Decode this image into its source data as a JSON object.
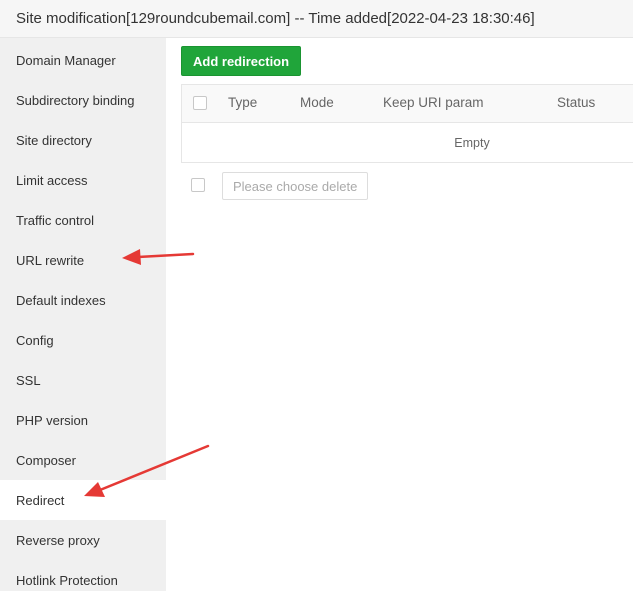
{
  "title": "Site modification[129roundcubemail.com] -- Time added[2022-04-23 18:30:46]",
  "sidebar": {
    "items": [
      {
        "label": "Domain Manager"
      },
      {
        "label": "Subdirectory binding"
      },
      {
        "label": "Site directory"
      },
      {
        "label": "Limit access"
      },
      {
        "label": "Traffic control"
      },
      {
        "label": "URL rewrite"
      },
      {
        "label": "Default indexes"
      },
      {
        "label": "Config"
      },
      {
        "label": "SSL"
      },
      {
        "label": "PHP version"
      },
      {
        "label": "Composer"
      },
      {
        "label": "Redirect"
      },
      {
        "label": "Reverse proxy"
      },
      {
        "label": "Hotlink Protection"
      }
    ],
    "active": "Redirect"
  },
  "main": {
    "add_button": "Add redirection",
    "table": {
      "columns": [
        "Type",
        "Mode",
        "Keep URI param",
        "Status"
      ],
      "empty_text": "Empty"
    },
    "delete_button": "Please choose delete"
  },
  "colors": {
    "primary_green": "#20a53a",
    "annotation_red": "#e53935",
    "sidebar_bg": "#f0f0f0"
  }
}
